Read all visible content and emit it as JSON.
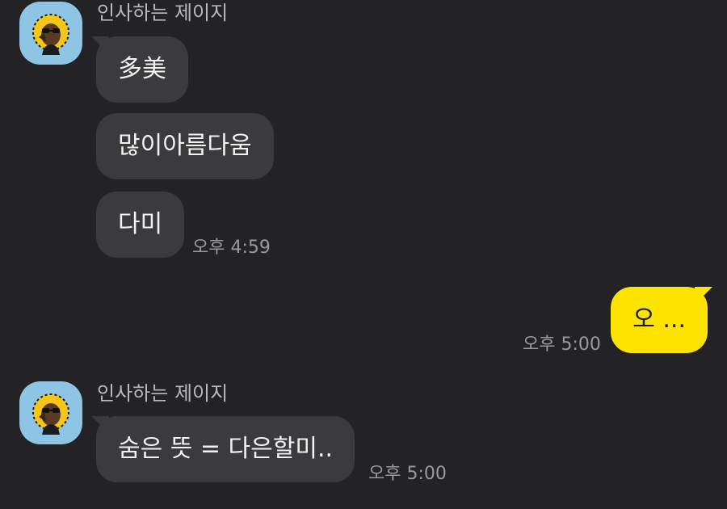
{
  "conversation": {
    "groups": [
      {
        "sender": "인사하는 제이지",
        "avatar_icon": "jay-g-character-icon",
        "messages": [
          {
            "text": "多美"
          },
          {
            "text": "많이아름다움"
          },
          {
            "text": "다미"
          }
        ],
        "time": "오후 4:59"
      },
      {
        "sender": "me",
        "messages": [
          {
            "text": "오 ..."
          }
        ],
        "time": "오후 5:00"
      },
      {
        "sender": "인사하는 제이지",
        "avatar_icon": "jay-g-character-icon",
        "messages": [
          {
            "text": "숨은 뜻 = 다은할미.."
          }
        ],
        "time": "오후 5:00"
      }
    ]
  },
  "colors": {
    "background": "#232325",
    "incoming_bubble": "#3b3b3e",
    "outgoing_bubble": "#fde300",
    "avatar_background": "#8ec4e4"
  }
}
